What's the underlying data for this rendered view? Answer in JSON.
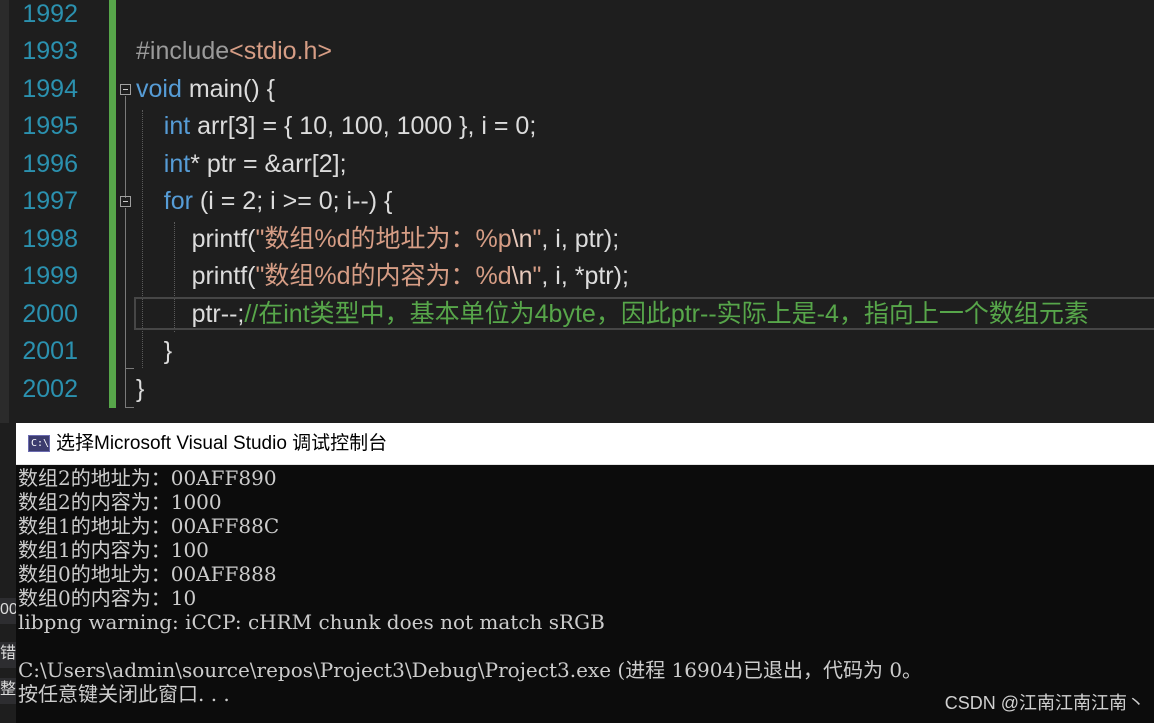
{
  "editor": {
    "lines": [
      {
        "num": "1992"
      },
      {
        "num": "1993",
        "pp": "#include",
        "inc": "<stdio.h>"
      },
      {
        "num": "1994",
        "kw": "void",
        "rest": " main() {"
      },
      {
        "num": "1995",
        "indent": "    ",
        "kw": "int",
        "rest": " arr[3] = { 10, 100, 1000 }, i = 0;"
      },
      {
        "num": "1996",
        "indent": "    ",
        "kw": "int",
        "rest": "* ptr = &arr[2];"
      },
      {
        "num": "1997",
        "indent": "    ",
        "kw": "for",
        "rest": " (i = 2; i >= 0; i--) {"
      },
      {
        "num": "1998",
        "indent": "        ",
        "pre": "printf(",
        "str": "\"数组%d的地址为：%p",
        "esc": "\\n",
        "strEnd": "\"",
        "post": ", i, ptr);"
      },
      {
        "num": "1999",
        "indent": "        ",
        "pre": "printf(",
        "str": "\"数组%d的内容为：%d",
        "esc": "\\n",
        "strEnd": "\"",
        "post": ", i, *ptr);"
      },
      {
        "num": "2000",
        "indent": "        ",
        "pre": "ptr--;",
        "cmt": "//在int类型中，基本单位为4byte，因此ptr--实际上是-4，指向上一个数组元素"
      },
      {
        "num": "2001",
        "indent": "    ",
        "pre": "}"
      },
      {
        "num": "2002",
        "pre": "}"
      }
    ]
  },
  "console": {
    "title": "选择Microsoft Visual Studio 调试控制台",
    "icon": "console-app-icon",
    "icon_glyph": "C:\\",
    "lines": [
      "数组2的地址为：00AFF890",
      "数组2的内容为：1000",
      "数组1的地址为：00AFF88C",
      "数组1的内容为：100",
      "数组0的地址为：00AFF888",
      "数组0的内容为：10",
      "libpng warning: iCCP: cHRM chunk does not match sRGB",
      "",
      "C:\\Users\\admin\\source\\repos\\Project3\\Debug\\Project3.exe (进程 16904)已退出，代码为 0。",
      "按任意键关闭此窗口. . ."
    ]
  },
  "side_fragments": [
    "00",
    "错误",
    "整"
  ],
  "watermark": "CSDN @江南江南江南丶",
  "colors": {
    "keyword": "#569cd6",
    "string": "#d69d85",
    "comment": "#57a64a",
    "line_number": "#2b91af",
    "change_bar": "#57a64a"
  }
}
